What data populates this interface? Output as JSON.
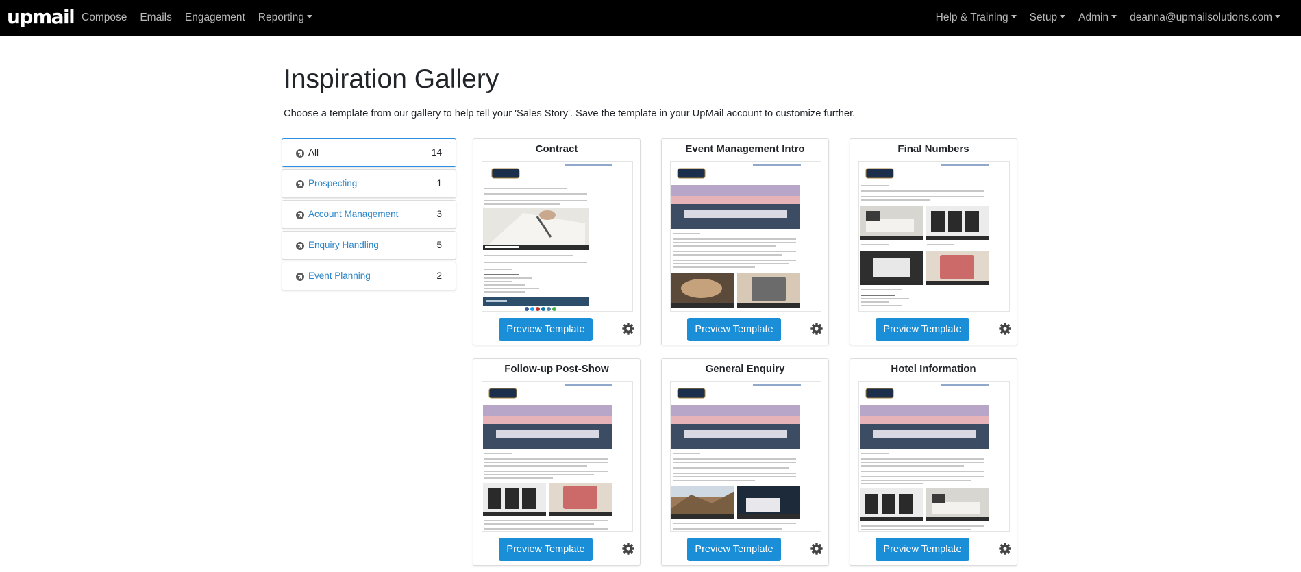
{
  "nav": {
    "brand": "upmail",
    "left_items": [
      "Compose",
      "Emails",
      "Engagement",
      "Reporting"
    ],
    "right_items": [
      "Help & Training",
      "Setup",
      "Admin",
      "deanna@upmailsolutions.com"
    ]
  },
  "page": {
    "title": "Inspiration Gallery",
    "lead": "Choose a template from our gallery to help tell your 'Sales Story'. Save the template in your UpMail account to customize further."
  },
  "categories": [
    {
      "label": "All",
      "count": "14"
    },
    {
      "label": "Prospecting",
      "count": "1"
    },
    {
      "label": "Account Management",
      "count": "3"
    },
    {
      "label": "Enquiry Handling",
      "count": "5"
    },
    {
      "label": "Event Planning",
      "count": "2"
    }
  ],
  "templates": [
    {
      "title": "Contract"
    },
    {
      "title": "Event Management Intro"
    },
    {
      "title": "Final Numbers"
    },
    {
      "title": "Follow-up Post-Show"
    },
    {
      "title": "General Enquiry"
    },
    {
      "title": "Hotel Information"
    }
  ],
  "buttons": {
    "preview": "Preview Template"
  },
  "colors": {
    "accent": "#1a8fd7",
    "navbar": "#000000",
    "link": "#2b86c9"
  }
}
